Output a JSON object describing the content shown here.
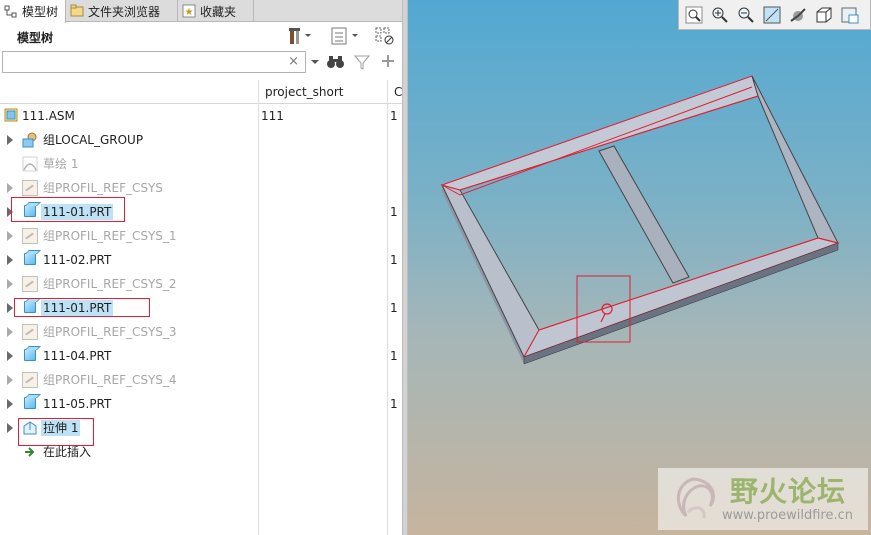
{
  "tabs": [
    {
      "label": "模型树",
      "icon": "model-tree-icon"
    },
    {
      "label": "文件夹浏览器",
      "icon": "folder-browser-icon"
    },
    {
      "label": "收藏夹",
      "icon": "favorites-icon"
    }
  ],
  "panel": {
    "title": "模型树",
    "search": {
      "value": "",
      "placeholder": "",
      "clear_glyph": "×"
    },
    "columns": [
      "project_short",
      "C"
    ]
  },
  "tree": {
    "root": {
      "label": "111.ASM",
      "col1": "111",
      "col2": "1"
    },
    "items": [
      {
        "label": "组LOCAL_GROUP",
        "state": "normal",
        "col2": ""
      },
      {
        "label": "草绘 1",
        "state": "dim",
        "col2": ""
      },
      {
        "label": "组PROFIL_REF_CSYS",
        "state": "dim",
        "col2": ""
      },
      {
        "label": "111-01.PRT",
        "state": "selected",
        "col2": "1"
      },
      {
        "label": "组PROFIL_REF_CSYS_1",
        "state": "dim",
        "col2": ""
      },
      {
        "label": "111-02.PRT",
        "state": "normal",
        "col2": "1"
      },
      {
        "label": "组PROFIL_REF_CSYS_2",
        "state": "dim",
        "col2": ""
      },
      {
        "label": "111-01.PRT",
        "state": "selected",
        "col2": "1"
      },
      {
        "label": "组PROFIL_REF_CSYS_3",
        "state": "dim",
        "col2": ""
      },
      {
        "label": "111-04.PRT",
        "state": "normal",
        "col2": "1"
      },
      {
        "label": "组PROFIL_REF_CSYS_4",
        "state": "dim",
        "col2": ""
      },
      {
        "label": "111-05.PRT",
        "state": "normal",
        "col2": "1"
      },
      {
        "label": "拉伸 1",
        "state": "selected",
        "col2": ""
      }
    ],
    "insert_here": "在此插入"
  },
  "viewport": {
    "toolbar_icons": [
      "refit-icon",
      "zoom-in-icon",
      "zoom-out-icon",
      "repaint-icon",
      "spin-center-icon",
      "display-style-icon",
      "saved-views-icon"
    ],
    "watermark": {
      "title": "野火论坛",
      "url": "www.proewildfire.cn"
    }
  },
  "colors": {
    "highlight": "#e21d32",
    "selection": "#bde2f6"
  }
}
